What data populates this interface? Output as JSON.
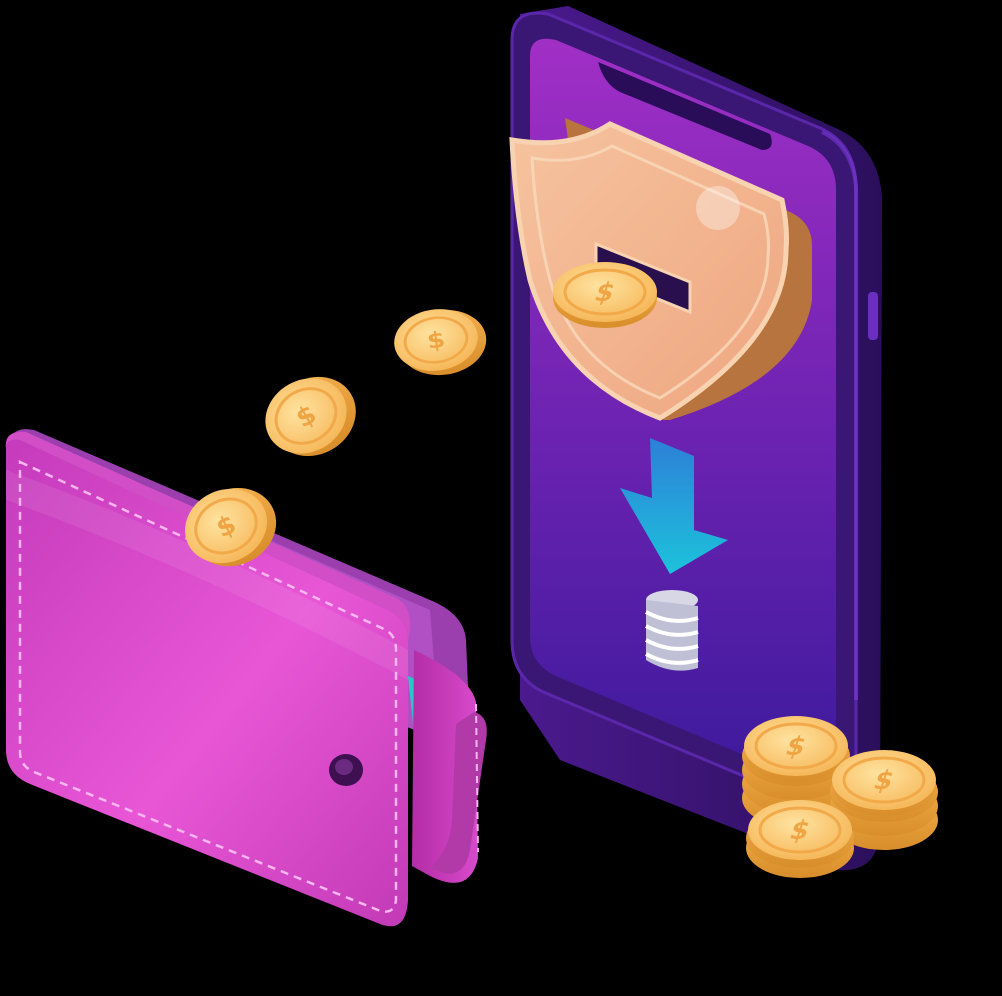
{
  "image": {
    "background_color": "#000000",
    "description_note": ""
  },
  "palette": {
    "phone_body": "#3a1672",
    "phone_edge": "#5a24a8",
    "phone_screen_top": "#9b2cc4",
    "phone_screen_bottom": "#3a1aa0",
    "shield_face": "#f3b58f",
    "shield_rim": "#f7cfa9",
    "arrow": "#22b8d8",
    "coin_gold": "#f9c15a",
    "coin_dark": "#e39a2c",
    "coin_symbol": "#f4ac44",
    "wallet_pink": "#e24ccf",
    "wallet_dark": "#a8239c",
    "wallet_stitch": "#f7b6ee",
    "card_teal": "#2ac6c9",
    "clasp": "#4a1560"
  },
  "icons": {
    "phone": "smartphone-icon",
    "shield": "shield-icon",
    "arrow": "arrow-down-icon",
    "coin_stack": "coin-stack-icon",
    "wallet": "wallet-icon",
    "coin": "dollar-coin-icon"
  }
}
